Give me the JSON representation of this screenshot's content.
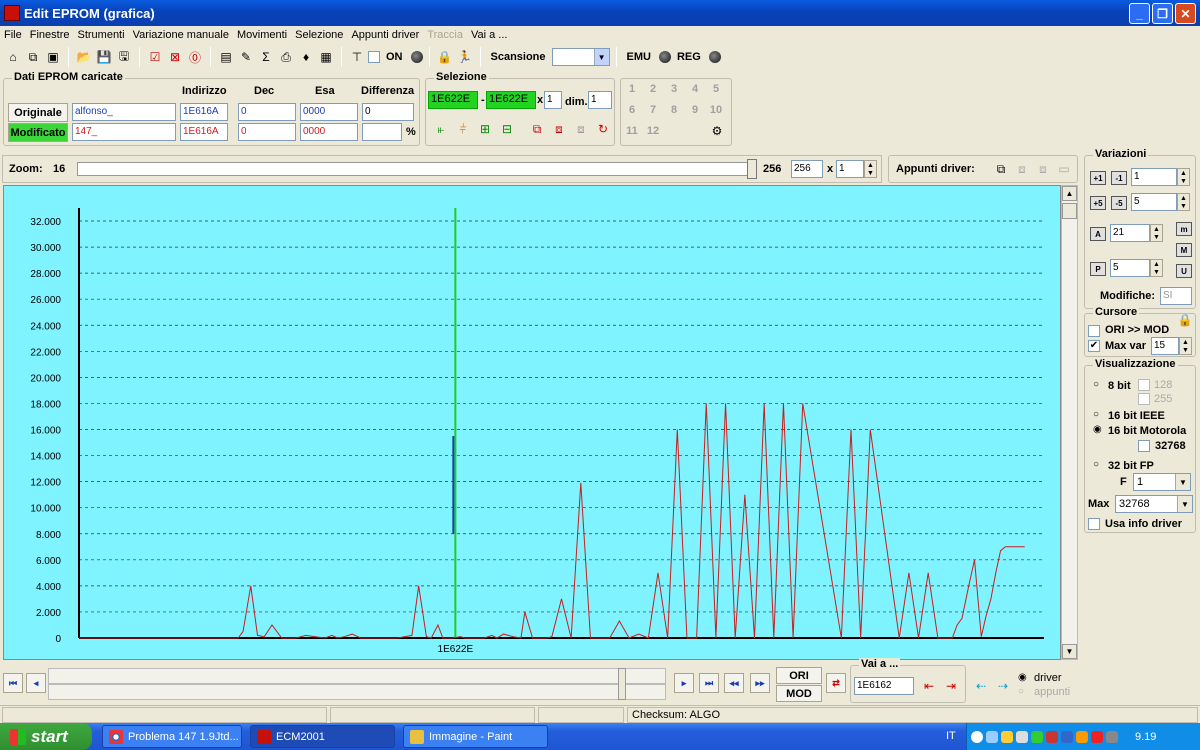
{
  "window": {
    "title": "Edit EPROM (grafica)"
  },
  "menu": [
    "File",
    "Finestre",
    "Strumenti",
    "Variazione manuale",
    "Movimenti",
    "Selezione",
    "Appunti driver",
    "Traccia",
    "Vai a ..."
  ],
  "menu_disabled_index": 7,
  "toolbar": {
    "on_label": "ON",
    "scansione_label": "Scansione",
    "emu_label": "EMU",
    "reg_label": "REG"
  },
  "dati_eprom": {
    "title": "Dati EPROM caricate",
    "headers": {
      "indirizzo": "Indirizzo",
      "dec": "Dec",
      "esa": "Esa",
      "differenza": "Differenza"
    },
    "originale": {
      "label": "Originale",
      "name": "alfonso_",
      "indirizzo": "1E616A",
      "dec": "0",
      "esa": "0000",
      "differenza": "0"
    },
    "modificato": {
      "label": "Modificato",
      "name": "147_",
      "indirizzo": "1E616A",
      "dec": "0",
      "esa": "0000",
      "differenza": "",
      "percent": "%"
    }
  },
  "selezione": {
    "title": "Selezione",
    "start": "1E622E",
    "dash": "-",
    "end": "1E622E",
    "x_label": "x",
    "x_value": "1",
    "dim_label": "dim.",
    "dim_value": "1"
  },
  "numbers": [
    "1",
    "2",
    "3",
    "4",
    "5",
    "6",
    "7",
    "8",
    "9",
    "10",
    "11",
    "12"
  ],
  "zoom": {
    "label": "Zoom:",
    "min": "16",
    "max": "256",
    "value": "256",
    "x_label": "x",
    "x_value": "1"
  },
  "appunti": {
    "label": "Appunti driver:"
  },
  "variazioni": {
    "title": "Variazioni",
    "v1": "1",
    "v2": "5",
    "v3": "21",
    "v4": "5",
    "modifiche_label": "Modifiche:",
    "modifiche_value": "SI"
  },
  "cursore": {
    "title": "Cursore",
    "ori_mod_label": "ORI >> MOD",
    "ori_mod_checked": false,
    "max_var_label": "Max var",
    "max_var_checked": true,
    "max_var_value": "15"
  },
  "visualizzazione": {
    "title": "Visualizzazione",
    "bit8": "8 bit",
    "c128": "128",
    "c255": "255",
    "ieee": "16 bit IEEE",
    "motorola": "16 bit Motorola",
    "c32768": "32768",
    "fp32": "32 bit FP",
    "f_label": "F",
    "f_value": "1",
    "max_label": "Max",
    "max_value": "32768",
    "usa_info": "Usa info driver",
    "selected": "16 bit Motorola"
  },
  "bottom": {
    "ori_label": "ORI",
    "mod_label": "MOD",
    "vai_label": "Vai a ...",
    "vai_value": "1E6162",
    "driver_label": "driver",
    "appunti_label": "appunti",
    "selected": "driver"
  },
  "status": {
    "checksum": "Checksum: ALGO"
  },
  "taskbar": {
    "start": "start",
    "tasks": [
      "Problema 147 1.9Jtd...",
      "ECM2001",
      "Immagine - Paint"
    ],
    "lang": "IT",
    "clock": "9.19"
  },
  "chart_data": {
    "type": "line",
    "ylim": [
      0,
      33000
    ],
    "yticks": [
      "0",
      "2.000",
      "4.000",
      "6.000",
      "8.000",
      "10.000",
      "12.000",
      "14.000",
      "16.000",
      "18.000",
      "20.000",
      "22.000",
      "24.000",
      "26.000",
      "28.000",
      "30.000",
      "32.000"
    ],
    "xlabel_marker": "1E622E",
    "background": "#7ff3ff",
    "series": [
      {
        "color": "#c81e1e",
        "x": [
          0,
          165,
          170,
          178,
          185,
          192,
          200,
          210,
          215,
          225,
          235,
          245,
          255,
          262,
          268,
          275,
          283,
          292,
          305,
          330,
          345,
          352,
          360,
          365,
          372,
          377,
          382,
          388,
          395,
          400,
          410,
          420,
          428,
          433,
          440,
          450,
          458,
          462,
          470,
          478,
          485,
          490,
          500,
          510,
          520,
          530,
          540,
          550,
          560,
          570,
          580,
          590,
          600,
          610,
          620,
          630,
          640,
          650,
          660,
          670,
          680,
          690,
          700,
          710,
          720,
          730,
          740,
          750,
          790,
          800,
          810,
          820,
          850,
          860,
          870,
          880,
          890,
          895,
          900,
          905,
          910,
          915,
          922,
          928,
          935,
          940,
          945,
          950,
          955,
          960,
          970,
          980
        ],
        "y": [
          0,
          0,
          500,
          4000,
          200,
          100,
          1000,
          0,
          0,
          0,
          200,
          100,
          0,
          200,
          0,
          100,
          300,
          0,
          0,
          0,
          200,
          4000,
          100,
          0,
          1000,
          0,
          0,
          0,
          100,
          0,
          0,
          0,
          200,
          0,
          300,
          100,
          0,
          2000,
          0,
          0,
          0,
          100,
          3000,
          0,
          11900,
          0,
          0,
          0,
          1300,
          0,
          300,
          0,
          5000,
          0,
          16000,
          0,
          0,
          18000,
          0,
          18000,
          0,
          11000,
          0,
          18000,
          0,
          18000,
          0,
          18000,
          0,
          16000,
          0,
          16000,
          0,
          5000,
          0,
          5000,
          0,
          0,
          0,
          0,
          1000,
          1500,
          4000,
          6000,
          100,
          1700,
          3000,
          5000,
          6700,
          7000,
          7000,
          7000
        ]
      }
    ]
  }
}
